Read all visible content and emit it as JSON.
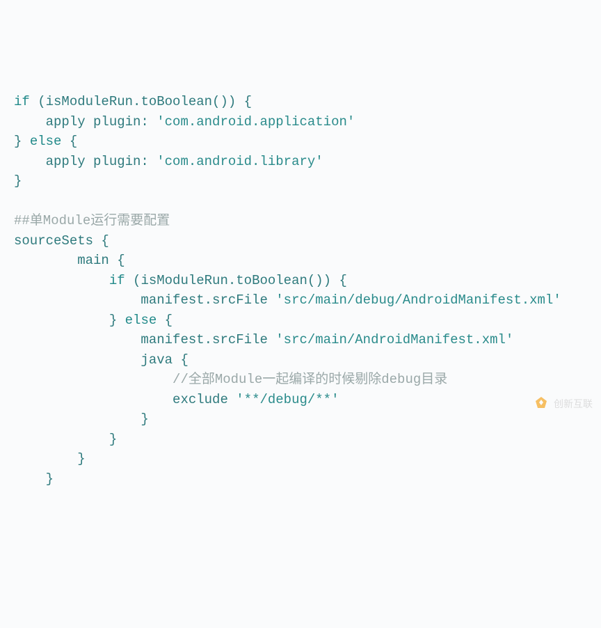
{
  "code": {
    "l1_kw_if": "if",
    "l1_cond": " (isModuleRun.toBoolean()) {",
    "l2_apply": "    apply plugin: ",
    "l2_str": "'com.android.application'",
    "l3_else": "} ",
    "l3_kw_else": "else",
    "l3_open": " {",
    "l4_apply": "    apply plugin: ",
    "l4_str": "'com.android.library'",
    "l5_close": "}",
    "l7_comment": "##单Module运行需要配置",
    "l8_srcsets": "sourceSets {",
    "l9_main": "        main {",
    "l10_indent": "            ",
    "l10_kw_if": "if",
    "l10_cond": " (isModuleRun.toBoolean()) {",
    "l11_mf": "                manifest.srcFile ",
    "l11_str": "'src/main/debug/AndroidManifest.xml'",
    "l12_close": "            } ",
    "l12_kw_else": "else",
    "l12_open": " {",
    "l13_mf": "                manifest.srcFile ",
    "l13_str": "'src/main/AndroidManifest.xml'",
    "l14_java": "                java {",
    "l15_comment": "                    //全部Module一起编译的时候剔除debug目录",
    "l16_excl": "                    exclude ",
    "l16_str": "'**/debug/**'",
    "l17_close": "                }",
    "l18_close": "            }",
    "l19_close": "        }",
    "l20_close": "    }"
  },
  "watermark": "创新互联"
}
